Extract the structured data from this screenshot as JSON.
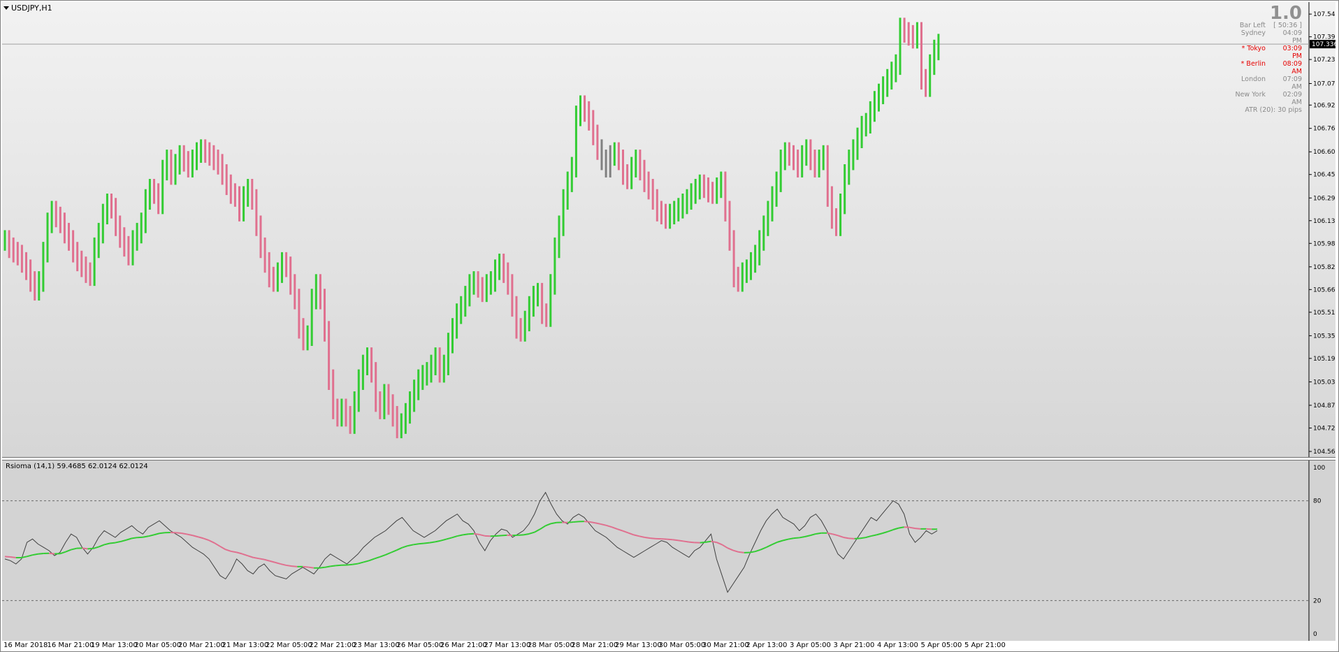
{
  "chart": {
    "symbol": "USDJPY,H1",
    "indicator_label": "Rsioma (14,1) 59.4685 62.0124 62.0124",
    "current_price_label": "107.336",
    "price_ticks": [
      "107.545",
      "107.390",
      "107.235",
      "107.071",
      "106.924",
      "106.765",
      "106.605",
      "106.450",
      "106.290",
      "106.135",
      "105.980",
      "105.820",
      "105.665",
      "105.510",
      "105.350",
      "105.195",
      "105.035",
      "104.875",
      "104.720",
      "104.560"
    ],
    "rsi_ticks": [
      "100",
      "80",
      "20",
      "0"
    ],
    "time_labels": [
      "16 Mar 2018",
      "16 Mar 21:00",
      "19 Mar 13:00",
      "20 Mar 05:00",
      "20 Mar 21:00",
      "21 Mar 13:00",
      "22 Mar 05:00",
      "22 Mar 21:00",
      "23 Mar 13:00",
      "26 Mar 05:00",
      "26 Mar 21:00",
      "27 Mar 13:00",
      "28 Mar 05:00",
      "28 Mar 21:00",
      "29 Mar 13:00",
      "30 Mar 05:00",
      "30 Mar 21:00",
      "2 Apr 13:00",
      "3 Apr 05:00",
      "3 Apr 21:00",
      "4 Apr 13:00",
      "5 Apr 05:00",
      "5 Apr 21:00"
    ],
    "colors": {
      "up": "#33cc33",
      "down": "#e0708f",
      "neutral": "#808080",
      "ma_up": "#33cc33",
      "ma_down": "#e0708f",
      "rsi_line": "#404040"
    },
    "price_range": [
      104.56,
      107.56
    ],
    "rsi_range": [
      0,
      100
    ],
    "rsi_levels": [
      80,
      20
    ],
    "info_panel": {
      "headline": "1.0",
      "rows": [
        {
          "label": "Bar Left",
          "value": "[ 50:36 ]",
          "highlight": false
        },
        {
          "label": "Sydney",
          "value": "04:09 PM",
          "highlight": false
        },
        {
          "label": "* Tokyo",
          "value": "03:09 PM",
          "highlight": true
        },
        {
          "label": "* Berlin",
          "value": "08:09 AM",
          "highlight": true
        },
        {
          "label": "London",
          "value": "07:09 AM",
          "highlight": false
        },
        {
          "label": "New York",
          "value": "02:09 AM",
          "highlight": false
        }
      ],
      "atr": "ATR (20): 30 pips"
    }
  },
  "chart_data": {
    "type": "bar",
    "price_series": [
      106.0,
      105.95,
      105.92,
      105.9,
      105.85,
      105.8,
      105.72,
      105.66,
      105.72,
      105.92,
      106.12,
      106.2,
      106.16,
      106.12,
      106.05,
      106.0,
      105.92,
      105.86,
      105.82,
      105.78,
      105.76,
      105.95,
      106.05,
      106.18,
      106.25,
      106.22,
      106.1,
      106.02,
      105.96,
      105.9,
      106.0,
      106.05,
      106.12,
      106.28,
      106.35,
      106.32,
      106.25,
      106.48,
      106.55,
      106.45,
      106.52,
      106.58,
      106.54,
      106.5,
      106.55,
      106.6,
      106.62,
      106.6,
      106.58,
      106.55,
      106.52,
      106.45,
      106.38,
      106.32,
      106.3,
      106.2,
      106.3,
      106.35,
      106.28,
      106.1,
      105.95,
      105.85,
      105.75,
      105.72,
      105.78,
      105.85,
      105.82,
      105.7,
      105.6,
      105.4,
      105.32,
      105.35,
      105.6,
      105.7,
      105.6,
      105.38,
      105.05,
      104.85,
      104.8,
      104.85,
      104.8,
      104.75,
      104.9,
      105.05,
      105.15,
      105.2,
      105.1,
      104.9,
      104.85,
      104.95,
      104.88,
      104.8,
      104.72,
      104.75,
      104.82,
      104.9,
      104.98,
      105.05,
      105.08,
      105.1,
      105.15,
      105.2,
      105.1,
      105.15,
      105.3,
      105.4,
      105.5,
      105.55,
      105.62,
      105.7,
      105.72,
      105.68,
      105.65,
      105.7,
      105.72,
      105.8,
      105.84,
      105.78,
      105.7,
      105.55,
      105.4,
      105.38,
      105.45,
      105.55,
      105.62,
      105.64,
      105.5,
      105.48,
      105.7,
      105.95,
      106.1,
      106.28,
      106.4,
      106.5,
      106.85,
      106.92,
      106.88,
      106.82,
      106.72,
      106.62,
      106.55,
      106.5,
      106.58,
      106.6,
      106.55,
      106.45,
      106.42,
      106.5,
      106.55,
      106.48,
      106.4,
      106.35,
      106.28,
      106.2,
      106.18,
      106.15,
      106.18,
      106.2,
      106.22,
      106.25,
      106.28,
      106.32,
      106.35,
      106.38,
      106.36,
      106.33,
      106.32,
      106.36,
      106.4,
      106.2,
      106.0,
      105.75,
      105.72,
      105.78,
      105.8,
      105.85,
      105.9,
      106.0,
      106.1,
      106.2,
      106.3,
      106.4,
      106.55,
      106.6,
      106.58,
      106.55,
      106.5,
      106.58,
      106.62,
      106.55,
      106.5,
      106.55,
      106.58,
      106.3,
      106.15,
      106.1,
      106.25,
      106.45,
      106.55,
      106.62,
      106.7,
      106.78,
      106.8,
      106.88,
      106.95,
      107.0,
      107.05,
      107.1,
      107.15,
      107.2,
      107.45,
      107.42,
      107.4,
      107.38,
      107.42,
      107.1,
      107.05,
      107.2,
      107.3,
      107.34
    ],
    "rsi_series": [
      45,
      44,
      42,
      45,
      55,
      57,
      54,
      52,
      50,
      47,
      49,
      55,
      60,
      58,
      52,
      48,
      52,
      58,
      62,
      60,
      58,
      61,
      63,
      65,
      62,
      60,
      64,
      66,
      68,
      65,
      62,
      60,
      58,
      55,
      52,
      50,
      48,
      45,
      40,
      35,
      33,
      38,
      45,
      42,
      38,
      36,
      40,
      42,
      38,
      35,
      34,
      33,
      36,
      38,
      40,
      38,
      36,
      40,
      45,
      48,
      46,
      44,
      42,
      45,
      48,
      52,
      55,
      58,
      60,
      62,
      65,
      68,
      70,
      66,
      62,
      60,
      58,
      60,
      62,
      65,
      68,
      70,
      72,
      68,
      66,
      62,
      55,
      50,
      56,
      60,
      63,
      62,
      58,
      60,
      62,
      66,
      72,
      80,
      85,
      78,
      72,
      68,
      66,
      70,
      72,
      70,
      66,
      62,
      60,
      58,
      55,
      52,
      50,
      48,
      46,
      48,
      50,
      52,
      54,
      56,
      55,
      52,
      50,
      48,
      46,
      50,
      52,
      56,
      60,
      45,
      35,
      25,
      30,
      35,
      40,
      48,
      55,
      62,
      68,
      72,
      75,
      70,
      68,
      66,
      62,
      65,
      70,
      72,
      68,
      62,
      55,
      48,
      45,
      50,
      55,
      60,
      65,
      70,
      68,
      72,
      76,
      80,
      78,
      72,
      60,
      55,
      58,
      62,
      60,
      62
    ],
    "ma_series": [
      46.5,
      46.2,
      45.8,
      45.8,
      46.5,
      47.4,
      48.0,
      48.3,
      48.4,
      48.1,
      48.2,
      49.3,
      50.6,
      51.4,
      51.5,
      51.1,
      51.3,
      52.3,
      53.6,
      54.4,
      54.8,
      55.5,
      56.4,
      57.4,
      57.9,
      58.1,
      58.7,
      59.5,
      60.4,
      60.8,
      60.9,
      60.8,
      60.5,
      59.9,
      59.2,
      58.3,
      57.4,
      56.2,
      54.6,
      52.6,
      50.7,
      49.6,
      49.0,
      48.1,
      47.0,
      45.9,
      45.3,
      44.7,
      43.8,
      42.9,
      42.0,
      41.2,
      40.7,
      40.4,
      40.4,
      40.1,
      39.6,
      39.6,
      40.0,
      40.6,
      41.0,
      41.3,
      41.4,
      41.7,
      42.2,
      43.1,
      44.0,
      45.2,
      46.3,
      47.5,
      48.9,
      50.3,
      51.8,
      52.9,
      53.6,
      54.1,
      54.4,
      54.8,
      55.3,
      56.0,
      56.9,
      57.8,
      58.8,
      59.5,
      60.0,
      60.2,
      59.7,
      58.9,
      58.7,
      58.8,
      59.1,
      59.3,
      59.2,
      59.3,
      59.5,
      60.1,
      61.1,
      62.9,
      65.0,
      66.3,
      66.9,
      67.0,
      66.9,
      67.2,
      67.5,
      67.6,
      67.3,
      66.7,
      66.0,
      65.2,
      64.2,
      63.0,
      61.9,
      60.7,
      59.5,
      58.7,
      58.0,
      57.5,
      57.2,
      57.1,
      56.9,
      56.6,
      56.2,
      55.7,
      55.2,
      54.9,
      54.8,
      55.1,
      55.6,
      55.0,
      53.6,
      51.6,
      50.2,
      49.2,
      48.8,
      48.9,
      49.5,
      50.6,
      52.0,
      53.6,
      55.1,
      56.1,
      56.9,
      57.5,
      57.8,
      58.4,
      59.2,
      60.1,
      60.6,
      60.6,
      60.0,
      59.1,
      58.0,
      57.4,
      57.2,
      57.4,
      57.9,
      58.8,
      59.5,
      60.4,
      61.4,
      62.6,
      63.6,
      64.2,
      64.0,
      63.4,
      63.1,
      63.1,
      62.9,
      62.9
    ]
  }
}
